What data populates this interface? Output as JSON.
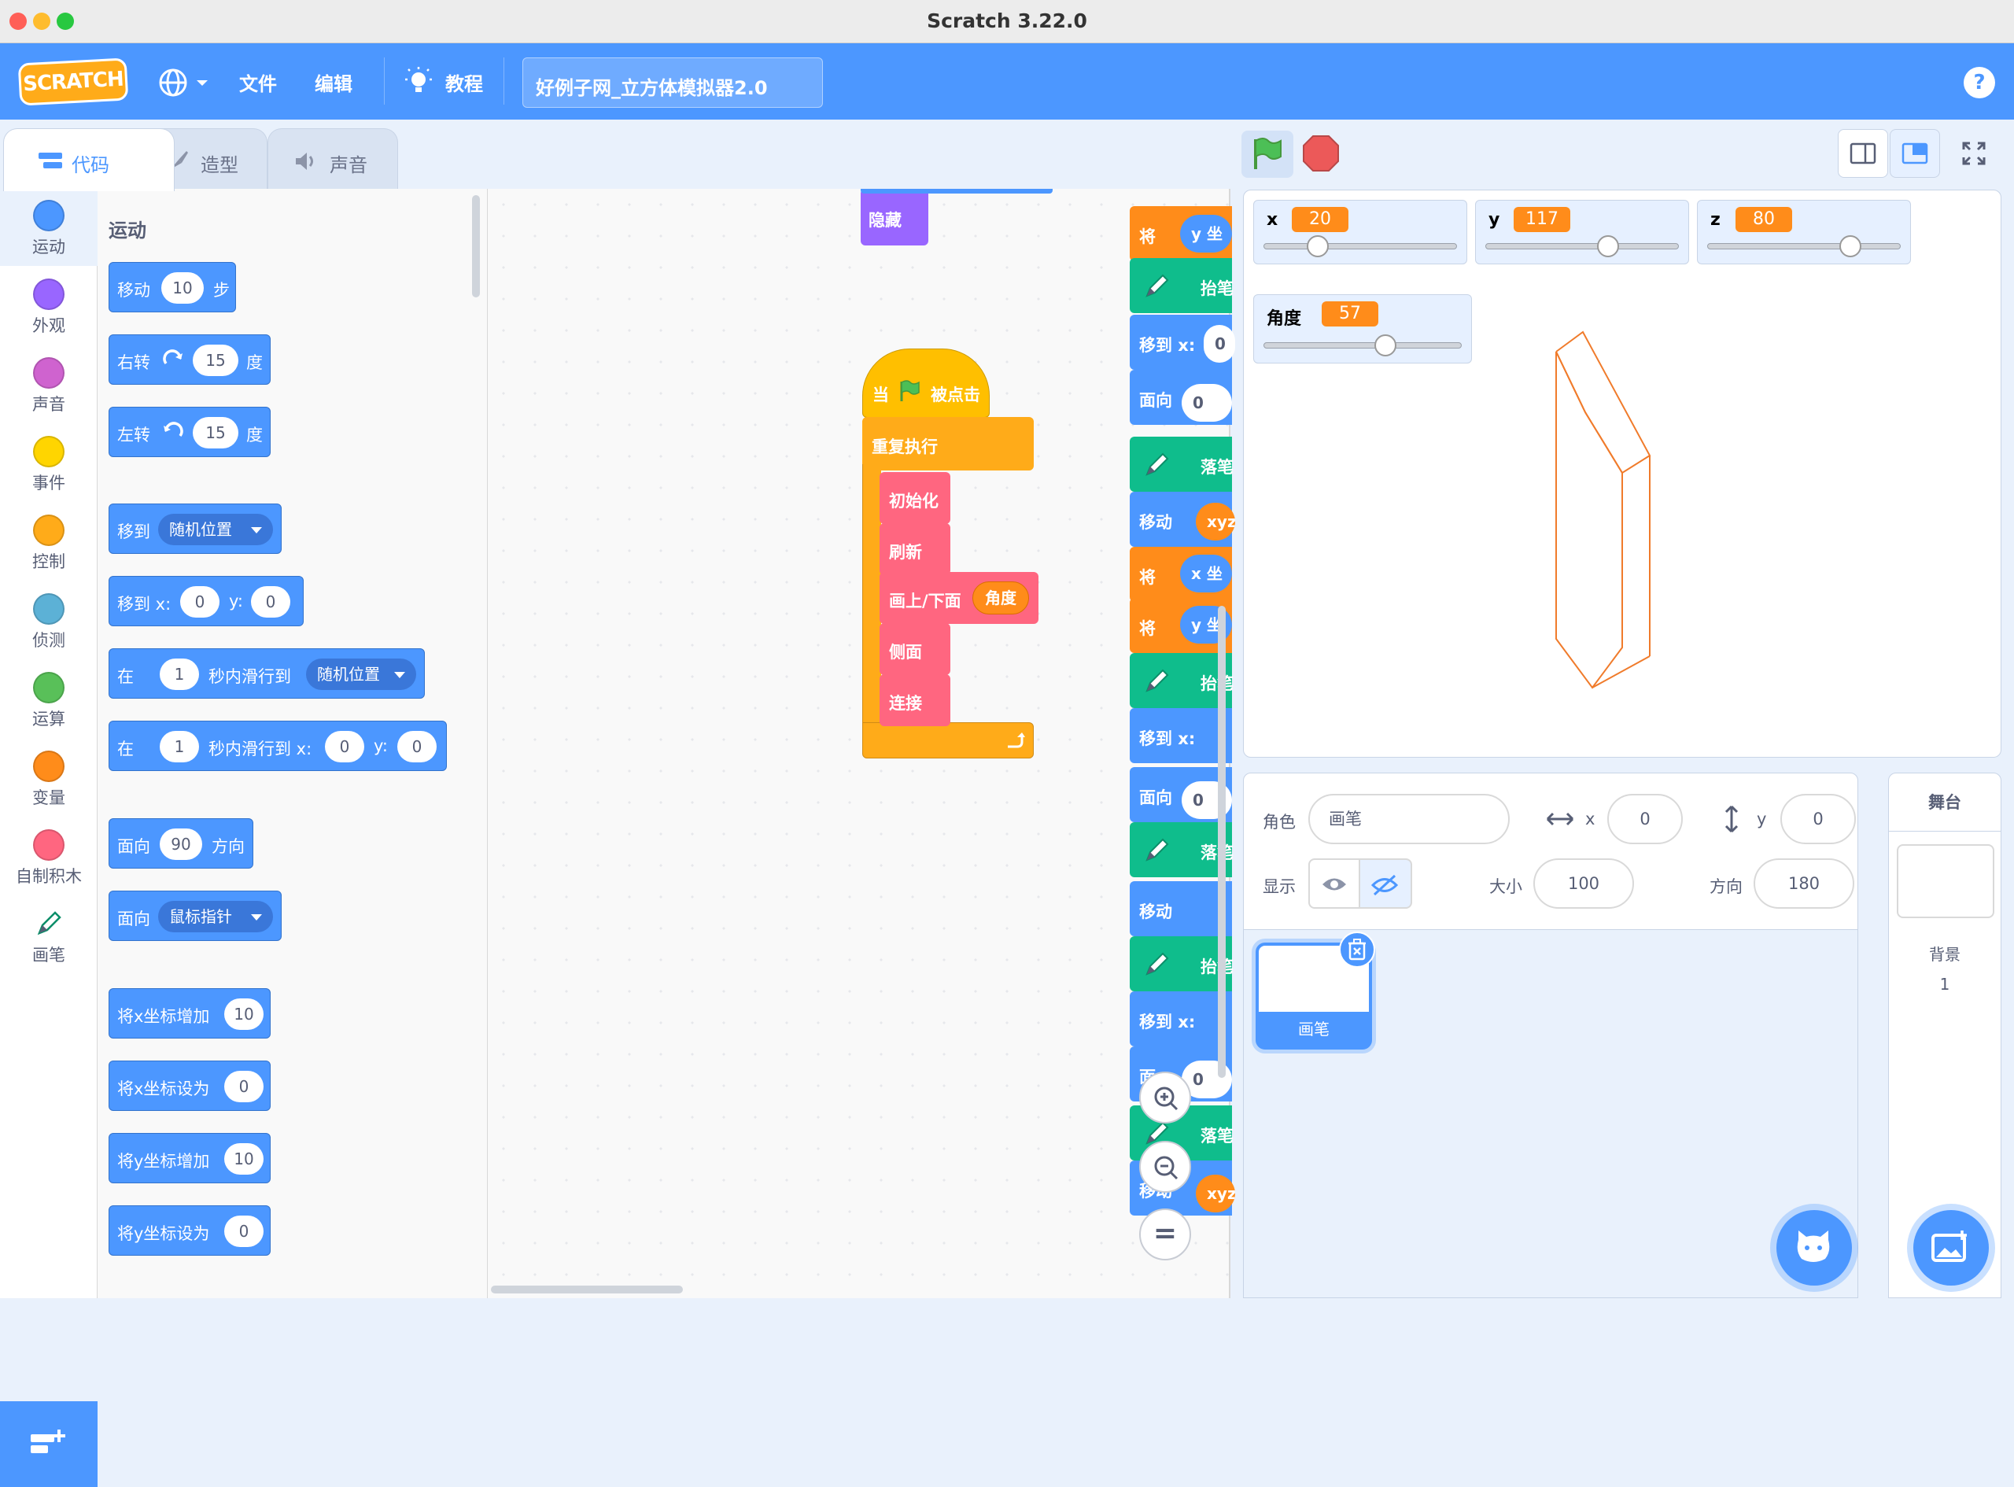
{
  "window": {
    "title": "Scratch 3.22.0"
  },
  "menubar": {
    "logo": "SCRATCH",
    "file": "文件",
    "edit": "编辑",
    "tutorials": "教程",
    "project_title": "好例子网_立方体模拟器2.0",
    "help": "?"
  },
  "tabs": {
    "code": "代码",
    "costumes": "造型",
    "sounds": "声音"
  },
  "categories": [
    {
      "label": "运动",
      "color": "#4c97ff"
    },
    {
      "label": "外观",
      "color": "#9966ff"
    },
    {
      "label": "声音",
      "color": "#cf63cf"
    },
    {
      "label": "事件",
      "color": "#ffd500"
    },
    {
      "label": "控制",
      "color": "#ffab19"
    },
    {
      "label": "侦测",
      "color": "#5cb1d6"
    },
    {
      "label": "运算",
      "color": "#59c059"
    },
    {
      "label": "变量",
      "color": "#ff8c1a"
    },
    {
      "label": "自制积木",
      "color": "#ff6680"
    },
    {
      "label": "画笔",
      "icon": "pen-icon"
    }
  ],
  "palette": {
    "title": "运动",
    "move": {
      "a": "移动",
      "v": "10",
      "b": "步"
    },
    "turn_right": {
      "a": "右转",
      "v": "15",
      "b": "度"
    },
    "turn_left": {
      "a": "左转",
      "v": "15",
      "b": "度"
    },
    "goto": {
      "a": "移到",
      "menu": "随机位置"
    },
    "goto_xy": {
      "a": "移到 x:",
      "x": "0",
      "y_label": "y:",
      "y": "0"
    },
    "glide": {
      "a": "在",
      "v": "1",
      "b": "秒内滑行到",
      "menu": "随机位置"
    },
    "glide_xy": {
      "a": "在",
      "v": "1",
      "b": "秒内滑行到 x:",
      "x": "0",
      "y_label": "y:",
      "y": "0"
    },
    "point_dir": {
      "a": "面向",
      "v": "90",
      "b": "方向"
    },
    "point_towards": {
      "a": "面向",
      "menu": "鼠标指针"
    },
    "change_x": {
      "a": "将x坐标增加",
      "v": "10"
    },
    "set_x": {
      "a": "将x坐标设为",
      "v": "0"
    },
    "change_y": {
      "a": "将y坐标增加",
      "v": "10"
    },
    "set_y": {
      "a": "将y坐标设为",
      "v": "0"
    }
  },
  "script": {
    "hide": "隐藏",
    "hat_when": "当",
    "hat_clicked": "被点击",
    "forever": "重复执行",
    "init": "初始化",
    "refresh": "刷新",
    "draw_updown": "画上/下面",
    "angle_reporter": "角度",
    "side": "侧面",
    "connect": "连接"
  },
  "right_column": [
    "将",
    "抬笔",
    "移到 x:",
    "面向",
    "落笔",
    "移动",
    "将",
    "将",
    "抬笔",
    "移到 x:",
    "面向",
    "落笔",
    "移动",
    "抬笔",
    "移到 x:",
    "面",
    "落笔",
    "移动"
  ],
  "right_column_extra": {
    "y_coord": "y 坐",
    "x_coord": "x 坐",
    "zero": "0",
    "xyz": "xyz"
  },
  "monitors": [
    {
      "name": "x",
      "value": "20",
      "level": 0.25
    },
    {
      "name": "y",
      "value": "117",
      "level": 0.65
    },
    {
      "name": "z",
      "value": "80",
      "level": 0.77
    },
    {
      "name": "角度",
      "value": "57",
      "level": 0.63
    }
  ],
  "sprite_info": {
    "sprite_label": "角色",
    "sprite_name": "画笔",
    "x_label": "x",
    "x": "0",
    "y_label": "y",
    "y": "0",
    "show_label": "显示",
    "size_label": "大小",
    "size": "100",
    "direction_label": "方向",
    "direction": "180"
  },
  "sprite_tile": {
    "name": "画笔"
  },
  "stage_panel": {
    "title": "舞台",
    "backdrops_label": "背景",
    "backdrops_count": "1"
  },
  "zoom": {
    "reset": "="
  },
  "colors": {
    "motion": "#4c97ff",
    "looks": "#9966ff",
    "control": "#ffab19",
    "events": "#ffbf00",
    "custom": "#ff6680",
    "pen": "#0fbd8c",
    "variables": "#ff8c1a",
    "cube_stroke": "#f07b2b"
  }
}
